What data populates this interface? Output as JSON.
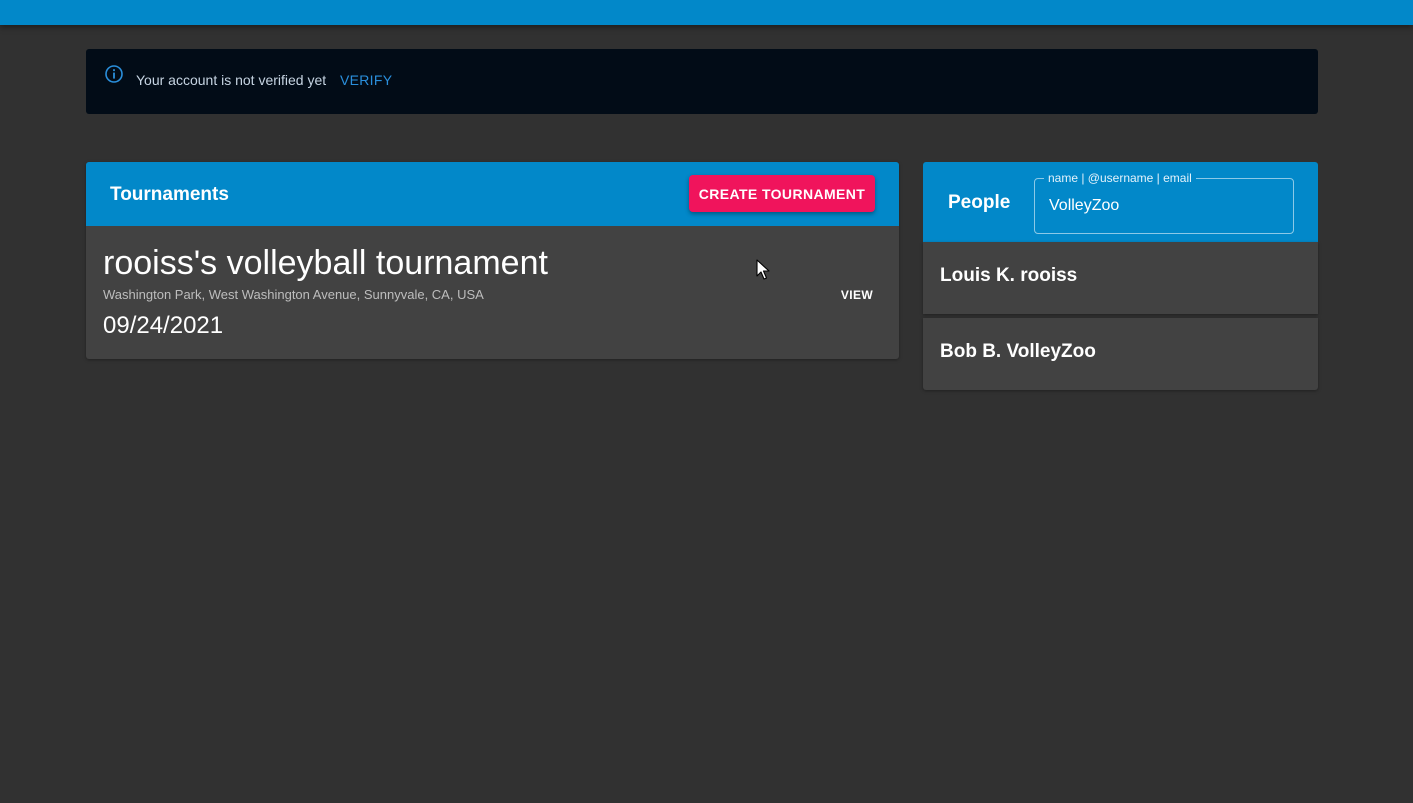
{
  "alert": {
    "message": "Your account is not verified yet",
    "action_label": "VERIFY",
    "icon": "info-icon"
  },
  "tournaments": {
    "title": "Tournaments",
    "create_label": "CREATE TOURNAMENT",
    "items": [
      {
        "name": "rooiss's volleyball tournament",
        "location": "Washington Park, West Washington Avenue, Sunnyvale, CA, USA",
        "date": "09/24/2021",
        "view_label": "VIEW"
      }
    ]
  },
  "people": {
    "title": "People",
    "search_label": "name | @username | email",
    "search_value": "VolleyZoo",
    "items": [
      {
        "name": "Louis K. rooiss"
      },
      {
        "name": "Bob B. VolleyZoo"
      }
    ]
  },
  "colors": {
    "app_bar": "#0288c9",
    "accent_button": "#f0145c",
    "background": "#313131",
    "card": "#424242",
    "alert_bg": "#020c17",
    "link": "#2a8fdc"
  }
}
